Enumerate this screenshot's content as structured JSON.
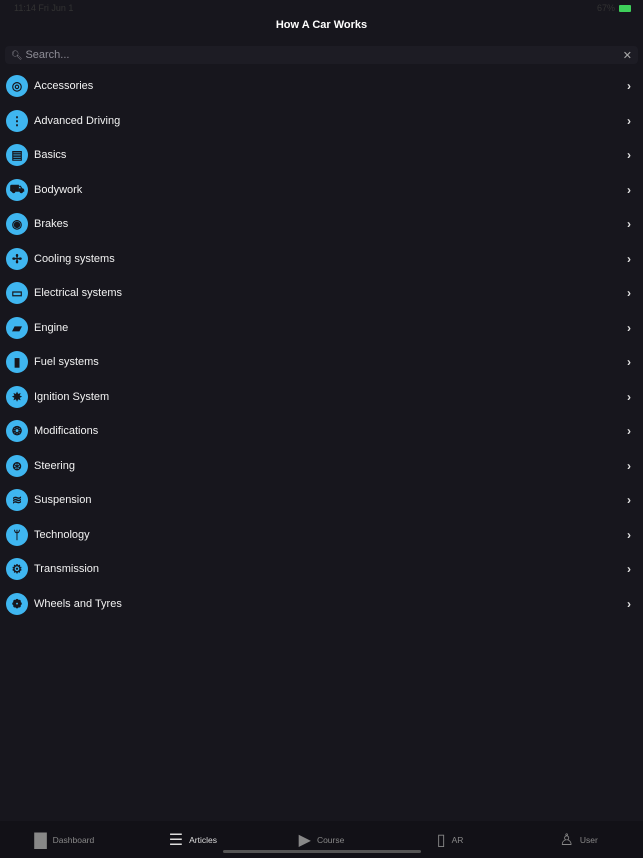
{
  "status": {
    "left": "11:14 Fri Jun 1",
    "right": "67%"
  },
  "header": {
    "title": "How A Car Works"
  },
  "search": {
    "placeholder": "Search..."
  },
  "categories": [
    {
      "label": "Accessories",
      "icon": "gauge-icon",
      "glyph": "◎"
    },
    {
      "label": "Advanced Driving",
      "icon": "traffic-light-icon",
      "glyph": "⋮"
    },
    {
      "label": "Basics",
      "icon": "manual-book-icon",
      "glyph": "▤"
    },
    {
      "label": "Bodywork",
      "icon": "car-front-icon",
      "glyph": "⛟"
    },
    {
      "label": "Brakes",
      "icon": "brake-disc-icon",
      "glyph": "◉"
    },
    {
      "label": "Cooling systems",
      "icon": "fan-icon",
      "glyph": "✢"
    },
    {
      "label": "Electrical systems",
      "icon": "battery-icon",
      "glyph": "▭"
    },
    {
      "label": "Engine",
      "icon": "engine-icon",
      "glyph": "▰"
    },
    {
      "label": "Fuel systems",
      "icon": "fuel-pump-icon",
      "glyph": "▮"
    },
    {
      "label": "Ignition System",
      "icon": "spark-icon",
      "glyph": "✸"
    },
    {
      "label": "Modifications",
      "icon": "turbo-icon",
      "glyph": "❂"
    },
    {
      "label": "Steering",
      "icon": "steering-wheel-icon",
      "glyph": "⊛"
    },
    {
      "label": "Suspension",
      "icon": "spring-icon",
      "glyph": "≋"
    },
    {
      "label": "Technology",
      "icon": "antenna-icon",
      "glyph": "ᛘ"
    },
    {
      "label": "Transmission",
      "icon": "gears-icon",
      "glyph": "⚙"
    },
    {
      "label": "Wheels and Tyres",
      "icon": "wheel-icon",
      "glyph": "❁"
    }
  ],
  "tabs": [
    {
      "label": "Dashboard",
      "icon": "bar-chart-icon",
      "glyph": "▇"
    },
    {
      "label": "Articles",
      "icon": "articles-icon",
      "glyph": "☰",
      "active": true
    },
    {
      "label": "Course",
      "icon": "play-icon",
      "glyph": "▶"
    },
    {
      "label": "AR",
      "icon": "ar-phone-icon",
      "glyph": "▯"
    },
    {
      "label": "User",
      "icon": "user-icon",
      "glyph": "♙"
    }
  ],
  "colors": {
    "accent": "#3fb6f0",
    "background": "#17161d"
  }
}
